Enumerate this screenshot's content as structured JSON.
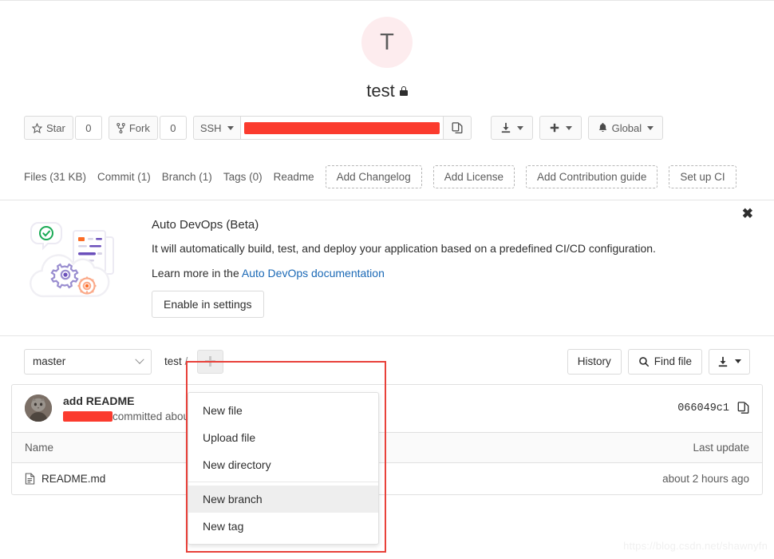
{
  "project": {
    "avatar_letter": "T",
    "name": "test",
    "visibility_icon": "lock-icon",
    "avatar_bg": "#fdecee"
  },
  "actions": {
    "star_label": "Star",
    "star_count": "0",
    "fork_label": "Fork",
    "fork_count": "0",
    "clone_protocol": "SSH",
    "clone_url_redacted": true,
    "copy_icon": "copy-icon",
    "download_icon": "download-icon",
    "plus_icon": "plus-icon",
    "notification_icon": "bell-icon",
    "notification_label": "Global"
  },
  "nav": {
    "links": [
      {
        "label": "Files (31 KB)"
      },
      {
        "label": "Commit (1)"
      },
      {
        "label": "Branch (1)"
      },
      {
        "label": "Tags (0)"
      },
      {
        "label": "Readme"
      }
    ],
    "suggestions": [
      {
        "label": "Add Changelog"
      },
      {
        "label": "Add License"
      },
      {
        "label": "Add Contribution guide"
      },
      {
        "label": "Set up CI"
      }
    ]
  },
  "devops": {
    "title": "Auto DevOps (Beta)",
    "description": "It will automatically build, test, and deploy your application based on a predefined CI/CD configuration.",
    "learn_prefix": "Learn more in the ",
    "learn_link": "Auto DevOps documentation",
    "enable_button": "Enable in settings",
    "close_icon": "close-icon",
    "link_color": "#1b69b6"
  },
  "repo_toolbar": {
    "branch": "master",
    "breadcrumb_root": "test",
    "breadcrumb_sep": "/",
    "add_button_icon": "plus-icon",
    "history_label": "History",
    "find_file_label": "Find file",
    "search_icon": "search-icon",
    "download_icon": "download-icon"
  },
  "dropdown": {
    "highlight_color": "#e8413a",
    "items": [
      {
        "label": "New file",
        "active": false
      },
      {
        "label": "Upload file",
        "active": false
      },
      {
        "label": "New directory",
        "active": false
      },
      {
        "label": "New branch",
        "active": true
      },
      {
        "label": "New tag",
        "active": false
      }
    ]
  },
  "commit": {
    "message": "add README",
    "author_redacted": true,
    "committed_text": "committed abou",
    "sha": "066049c1",
    "copy_icon": "copy-icon",
    "avatar_icon": "user-avatar"
  },
  "files": {
    "headers": {
      "name": "Name",
      "last_update": "Last update"
    },
    "rows": [
      {
        "icon": "file-icon",
        "name": "README.md",
        "last_update": "about 2 hours ago"
      }
    ]
  },
  "watermark": "https://blog.csdn.net/shawnyfn"
}
